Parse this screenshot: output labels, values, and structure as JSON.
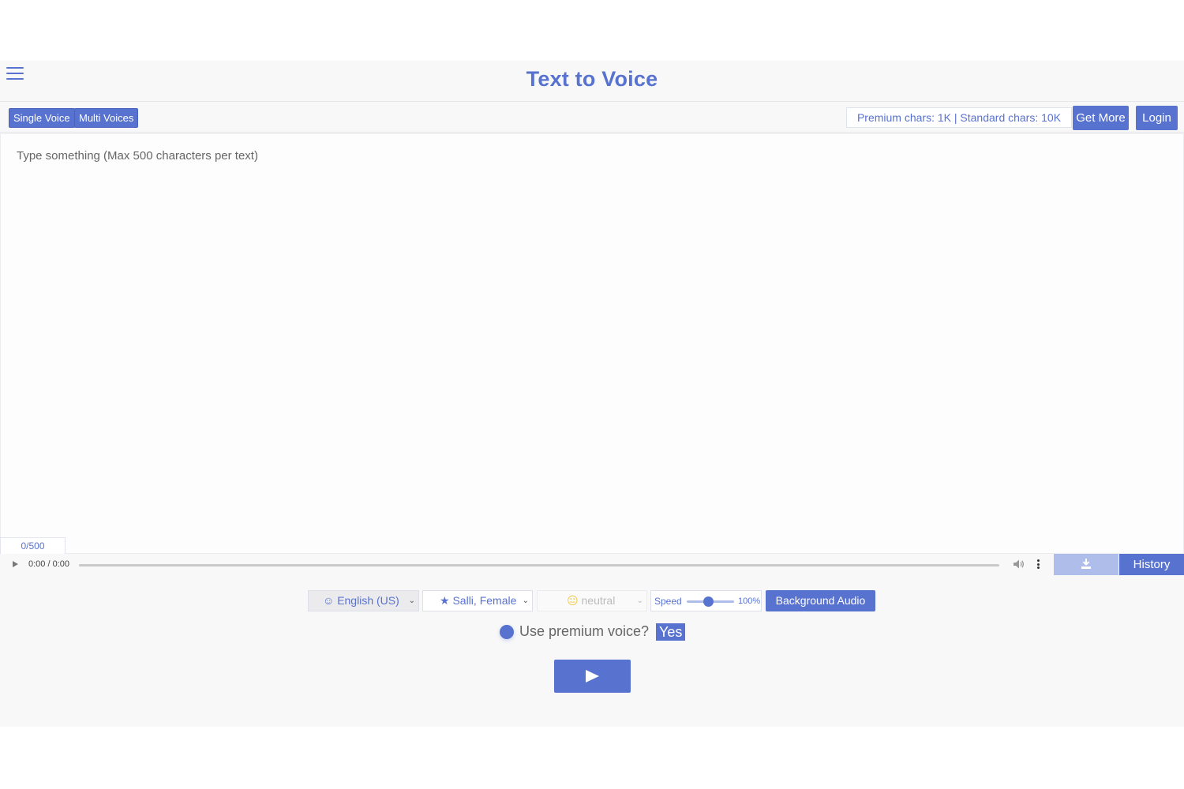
{
  "header": {
    "title": "Text to Voice",
    "menu_icon": "hamburger-menu-icon"
  },
  "toolbar": {
    "single_voice_label": "Single Voice",
    "multi_voices_label": "Multi Voices",
    "chars_info": "Premium chars: 1K | Standard chars: 10K",
    "get_more_label": "Get More",
    "login_label": "Login"
  },
  "editor": {
    "placeholder": "Type something (Max 500 characters per text)",
    "value": "",
    "counter": "0/500"
  },
  "player": {
    "time": "0:00 / 0:00",
    "play_icon": "play-icon",
    "volume_icon": "volume-icon",
    "more_icon": "more-vertical-icon",
    "download_icon": "download-icon",
    "history_label": "History"
  },
  "controls": {
    "language": "English (US)",
    "language_icon": "smiley-icon",
    "voice": "Salli, Female",
    "voice_icon": "star-icon",
    "mood": "neutral",
    "mood_icon": "neutral-face-icon",
    "speed_label": "Speed",
    "speed_value": "100%",
    "speed_slider_fraction": 0.45,
    "background_audio_label": "Background Audio"
  },
  "premium": {
    "question": "Use premium voice?",
    "answer": "Yes"
  },
  "colors": {
    "accent": "#5872d0",
    "accent_light": "#aebde9",
    "background": "#f8f8f9"
  }
}
